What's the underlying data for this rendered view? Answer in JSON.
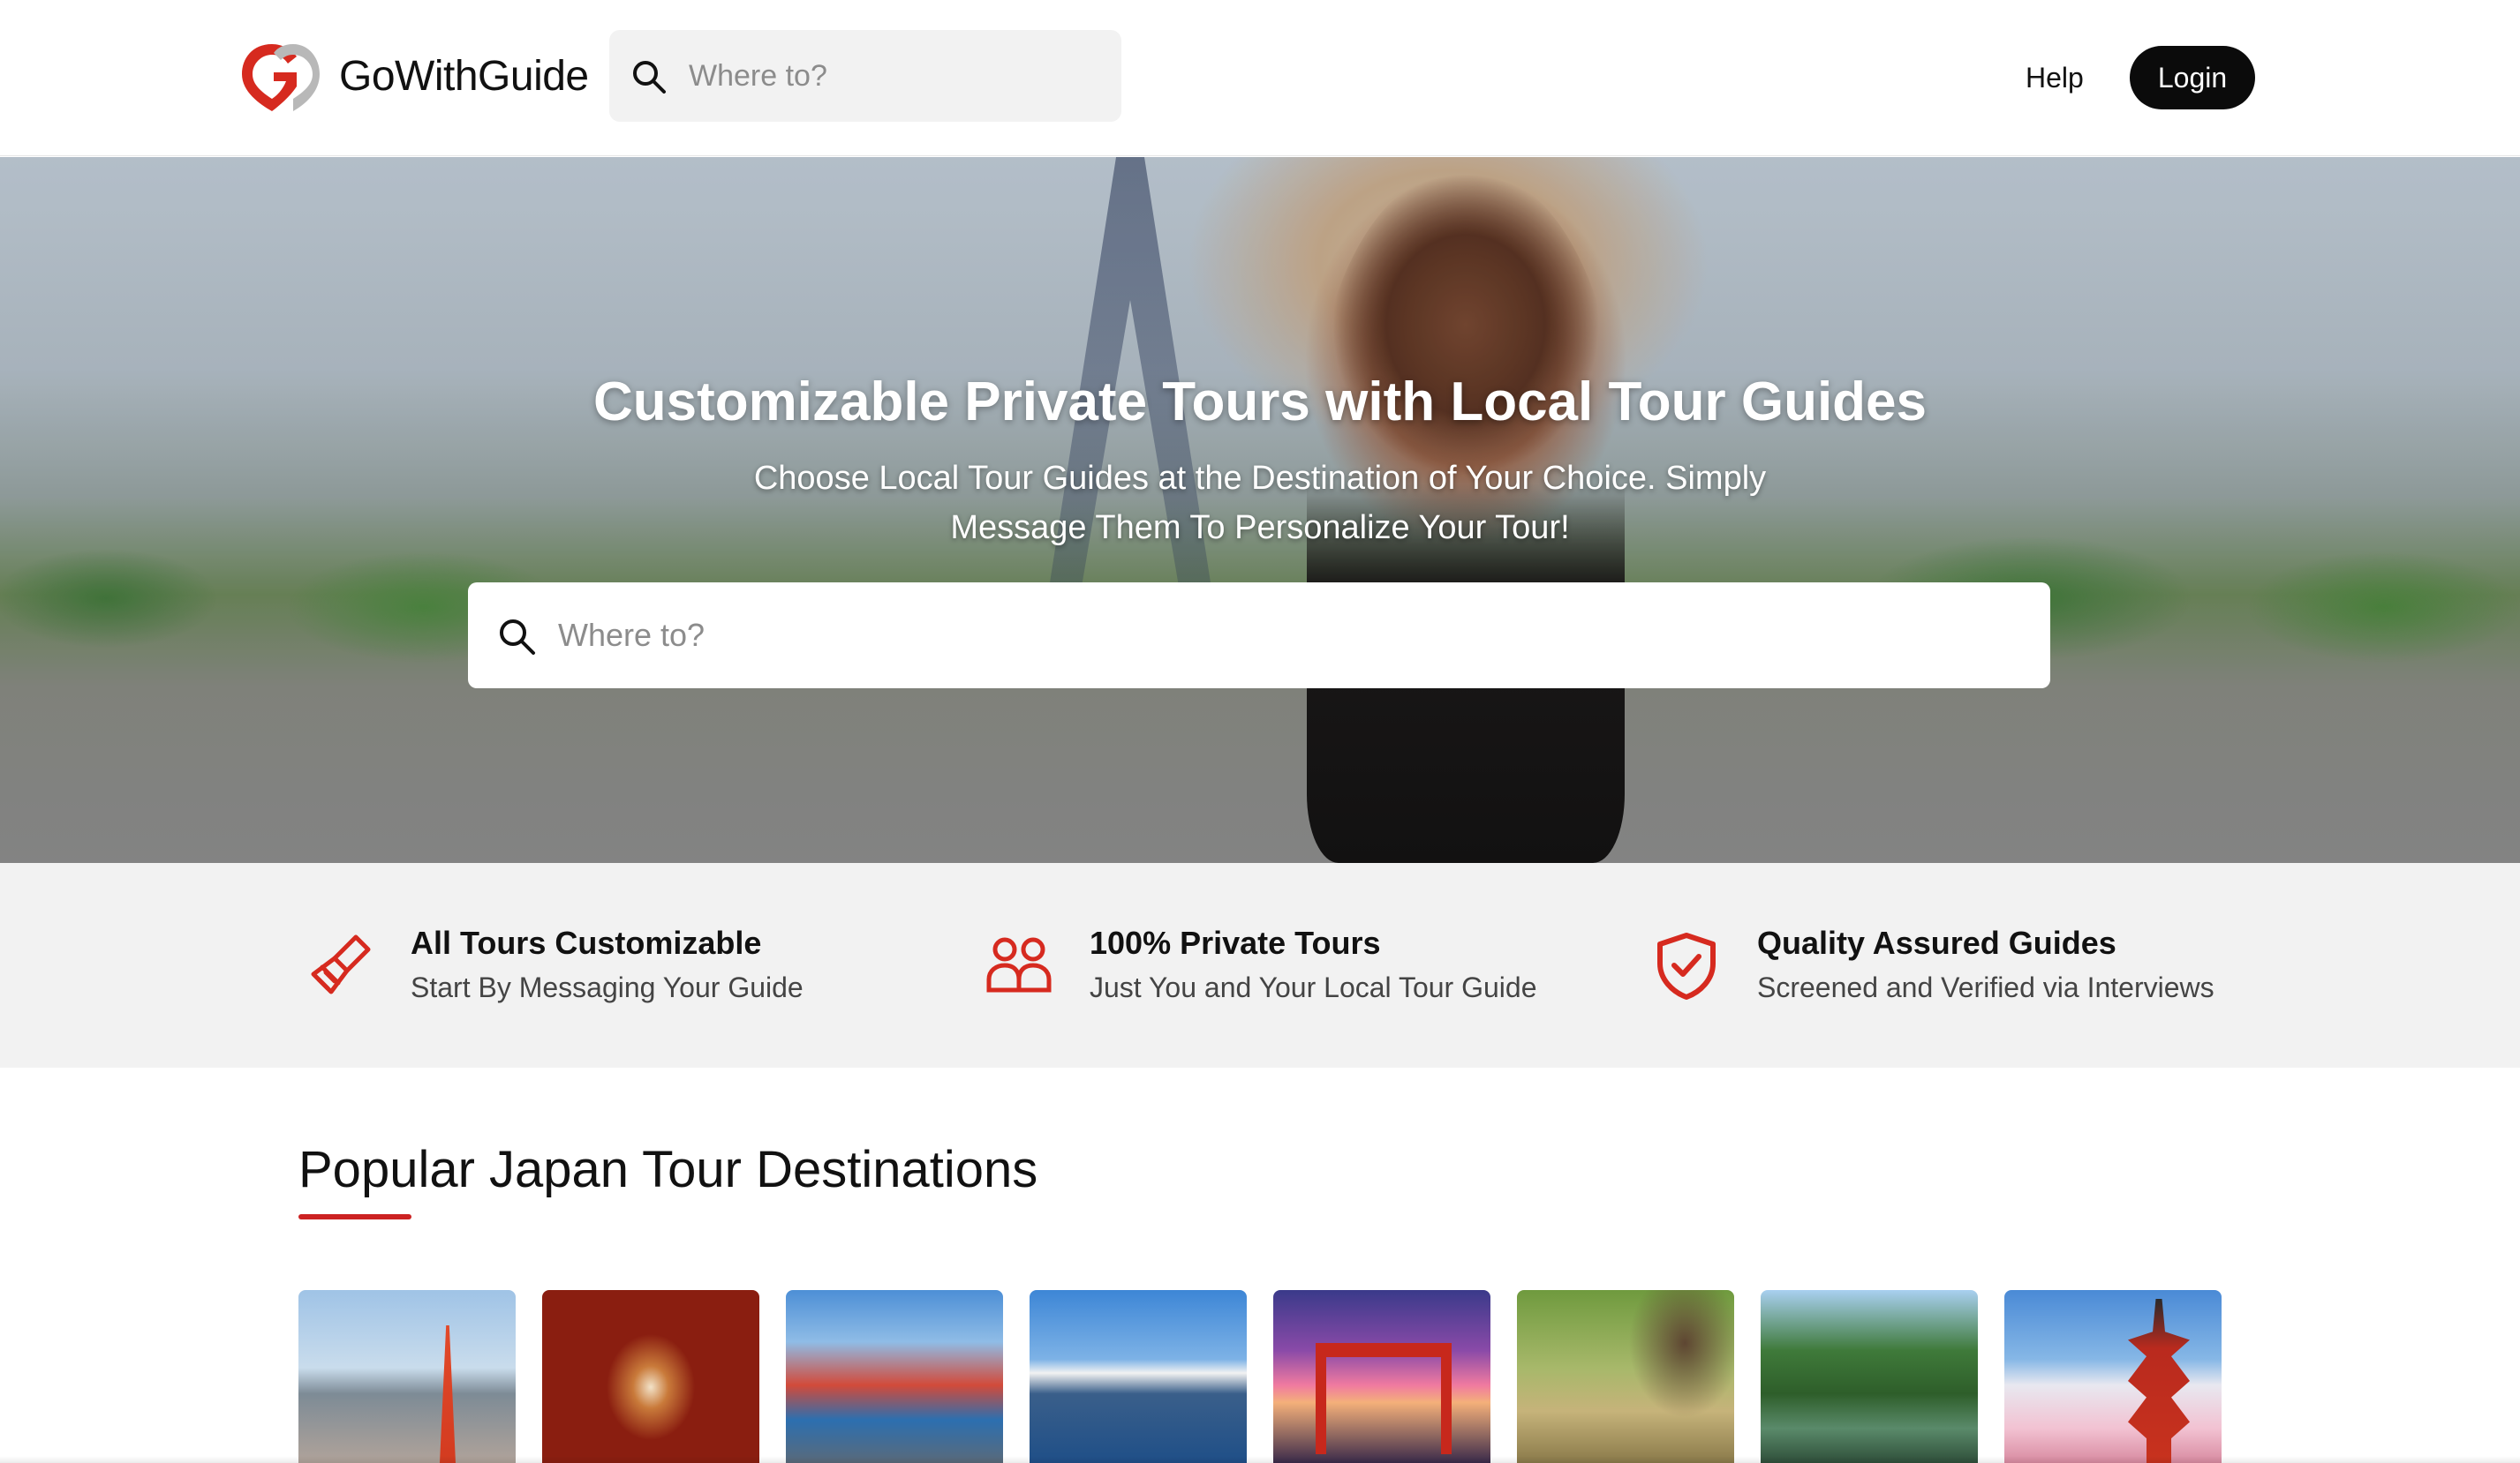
{
  "header": {
    "brand": "GoWithGuide",
    "search_placeholder": "Where to?",
    "help_label": "Help",
    "login_label": "Login",
    "logo_colors": [
      "#d62a1f",
      "#b8b8b8"
    ]
  },
  "hero": {
    "title": "Customizable Private Tours with Local Tour Guides",
    "subtitle": "Choose Local Tour Guides at the Destination of Your Choice. Simply Message Them To Personalize Your Tour!",
    "search_placeholder": "Where to?"
  },
  "features": [
    {
      "icon": "paintbrush-icon",
      "title": "All Tours Customizable",
      "desc": "Start By Messaging Your Guide"
    },
    {
      "icon": "people-icon",
      "title": "100% Private Tours",
      "desc": "Just You and Your Local Tour Guide"
    },
    {
      "icon": "shield-check-icon",
      "title": "Quality Assured Guides",
      "desc": "Screened and Verified via Interviews"
    }
  ],
  "popular": {
    "title": "Popular Japan Tour Destinations",
    "accent_color": "#cc2222",
    "destinations": [
      {
        "image": "tokyo-tower-cityscape"
      },
      {
        "image": "red-torii-tunnel"
      },
      {
        "image": "osaka-dotonbori-signs"
      },
      {
        "image": "lake-ship-mount-fuji"
      },
      {
        "image": "floating-torii-sunset"
      },
      {
        "image": "deer-under-tree"
      },
      {
        "image": "garden-pond-pines"
      },
      {
        "image": "pagoda-mount-fuji"
      }
    ]
  },
  "colors": {
    "brand_red": "#d62a1f",
    "login_bg": "#0b0b0b",
    "feature_band": "#f2f2f2"
  }
}
